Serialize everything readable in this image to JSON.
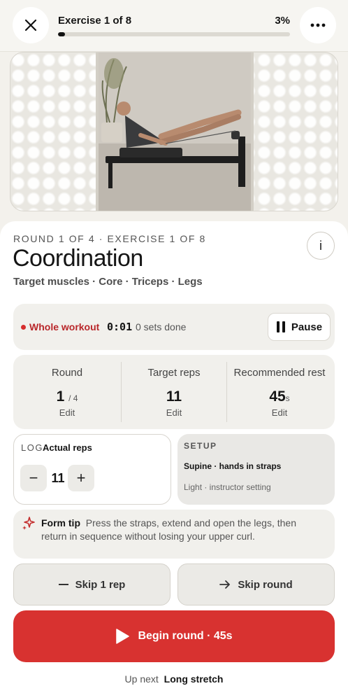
{
  "header": {
    "progress_title": "Exercise 1 of 8",
    "progress_percent_label": "3%",
    "progress_fraction": 0.03,
    "close_icon": "close-icon",
    "more_icon": "more-icon"
  },
  "exercise": {
    "eyebrow": "ROUND 1 OF 4 · EXERCISE 1 OF 8",
    "title": "Coordination",
    "muscles": "Target muscles · Core · Triceps · Legs",
    "info_label": "i"
  },
  "timer": {
    "label": "Whole workout",
    "time": "0:01",
    "sets": "0 sets done",
    "pause_label": "Pause",
    "dot_color": "#d62e2e"
  },
  "stats": {
    "round": {
      "label": "Round",
      "value": "1",
      "suffix": "/ 4",
      "edit": "Edit"
    },
    "reps": {
      "label": "Target reps",
      "value": "11",
      "edit": "Edit"
    },
    "rest": {
      "label": "Recommended rest",
      "value": "45",
      "suffix": "s",
      "edit": "Edit"
    }
  },
  "log": {
    "tag": "LOG",
    "title": "Actual reps",
    "value": "11",
    "minus": "−",
    "plus": "+"
  },
  "setup": {
    "tag": "SETUP",
    "line1": "Supine · hands in straps",
    "line2": "Light · instructor setting"
  },
  "tip": {
    "label": "Form tip",
    "text": "Press the straps, extend and open the legs, then return in sequence without losing your upper curl."
  },
  "actions": {
    "skip_rep": "Skip 1 rep",
    "skip_round": "Skip round",
    "begin": "Begin round · 45s",
    "accent": "#d83230"
  },
  "upnext": {
    "label": "Up next",
    "value": "Long stretch"
  }
}
